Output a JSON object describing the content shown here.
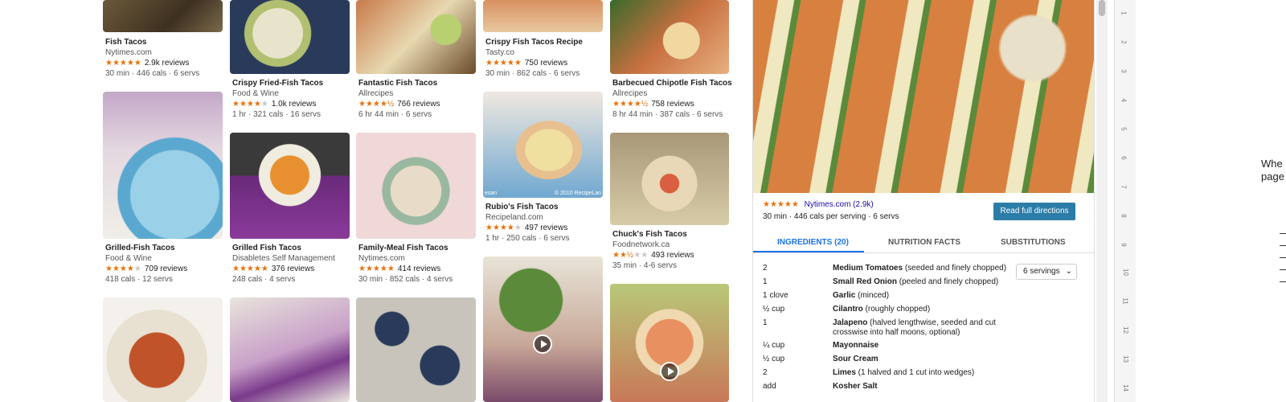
{
  "grid": {
    "cards": [
      {
        "title": "Fish Tacos",
        "source": "Nytimes.com",
        "stars": 5,
        "reviews": "2.9k reviews",
        "meta": "30 min · 446 cals · 6 servs"
      },
      {
        "title": "Crispy Fried-Fish Tacos",
        "source": "Food & Wine",
        "stars": 4,
        "reviews": "1.0k reviews",
        "meta": "1 hr · 321 cals · 16 servs"
      },
      {
        "title": "Fantastic Fish Tacos",
        "source": "Allrecipes",
        "stars": 4.5,
        "reviews": "766 reviews",
        "meta": "6 hr 44 min · 6 servs"
      },
      {
        "title": "Crispy Fish Tacos Recipe",
        "source": "Tasty.co",
        "stars": 5,
        "reviews": "750 reviews",
        "meta": "30 min · 862 cals · 6 servs"
      },
      {
        "title": "Barbecued Chipotle Fish Tacos",
        "source": "Allrecipes",
        "stars": 4.5,
        "reviews": "758 reviews",
        "meta": "8 hr 44 min · 387 cals · 6 servs"
      },
      {
        "title": "Grilled-Fish Tacos",
        "source": "Food & Wine",
        "stars": 4,
        "reviews": "709 reviews",
        "meta": "418 cals · 12 servs"
      },
      {
        "title": "Grilled Fish Tacos",
        "source": "Disabletes Self Management",
        "stars": 5,
        "reviews": "376 reviews",
        "meta": "248 cals · 4 servs"
      },
      {
        "title": "Family-Meal Fish Tacos",
        "source": "Nytimes.com",
        "stars": 5,
        "reviews": "414 reviews",
        "meta": "30 min · 852 cals · 4 servs"
      },
      {
        "title": "Rubio's Fish Tacos",
        "source": "Recipeland.com",
        "stars": 4,
        "reviews": "497 reviews",
        "meta": "1 hr · 250 cals · 6 servs"
      },
      {
        "title": "Chuck's Fish Tacos",
        "source": "Foodnetwork.ca",
        "stars": 2.5,
        "reviews": "493 reviews",
        "meta": "35 min · 4-6 servs"
      }
    ],
    "image_watermark": "© 2010 RecipeLan",
    "image_watermark_left": "esan"
  },
  "panel": {
    "rating_source": "Nytimes.com (2.9k)",
    "summary": "30 min · 446 cals per serving · 6 servs",
    "read_button": "Read full directions",
    "tabs": [
      "INGREDIENTS (20)",
      "NUTRITION FACTS",
      "SUBSTITUTIONS"
    ],
    "servings": "6 servings",
    "ingredients": [
      {
        "qty": "2",
        "name": "Medium Tomatoes",
        "note": " (seeded and finely chopped)"
      },
      {
        "qty": "1",
        "name": "Small Red Onion",
        "note": " (peeled and finely chopped)"
      },
      {
        "qty": "1 clove",
        "name": "Garlic",
        "note": " (minced)"
      },
      {
        "qty": "½ cup",
        "name": "Cilantro",
        "note": " (roughly chopped)"
      },
      {
        "qty": "1",
        "name": "Jalapeno",
        "note": " (halved lengthwise, seeded and cut crosswise into half moons, optional)"
      },
      {
        "qty": "¼ cup",
        "name": "Mayonnaise",
        "note": ""
      },
      {
        "qty": "½ cup",
        "name": "Sour Cream",
        "note": ""
      },
      {
        "qty": "2",
        "name": "Limes",
        "note": " (1 halved and 1 cut into wedges)"
      },
      {
        "qty": "add",
        "name": "Kosher Salt",
        "note": ""
      }
    ]
  },
  "ruler_numbers": [
    "1",
    "2",
    "3",
    "4",
    "5",
    "6",
    "7",
    "8",
    "9",
    "10",
    "11",
    "12",
    "13",
    "14"
  ],
  "doc_text": [
    "Whe",
    "page"
  ],
  "colors": {
    "accent": "#1a73e8",
    "button": "#2b7da8",
    "tab_active": "#1a73e8",
    "star": "#e8710a"
  }
}
